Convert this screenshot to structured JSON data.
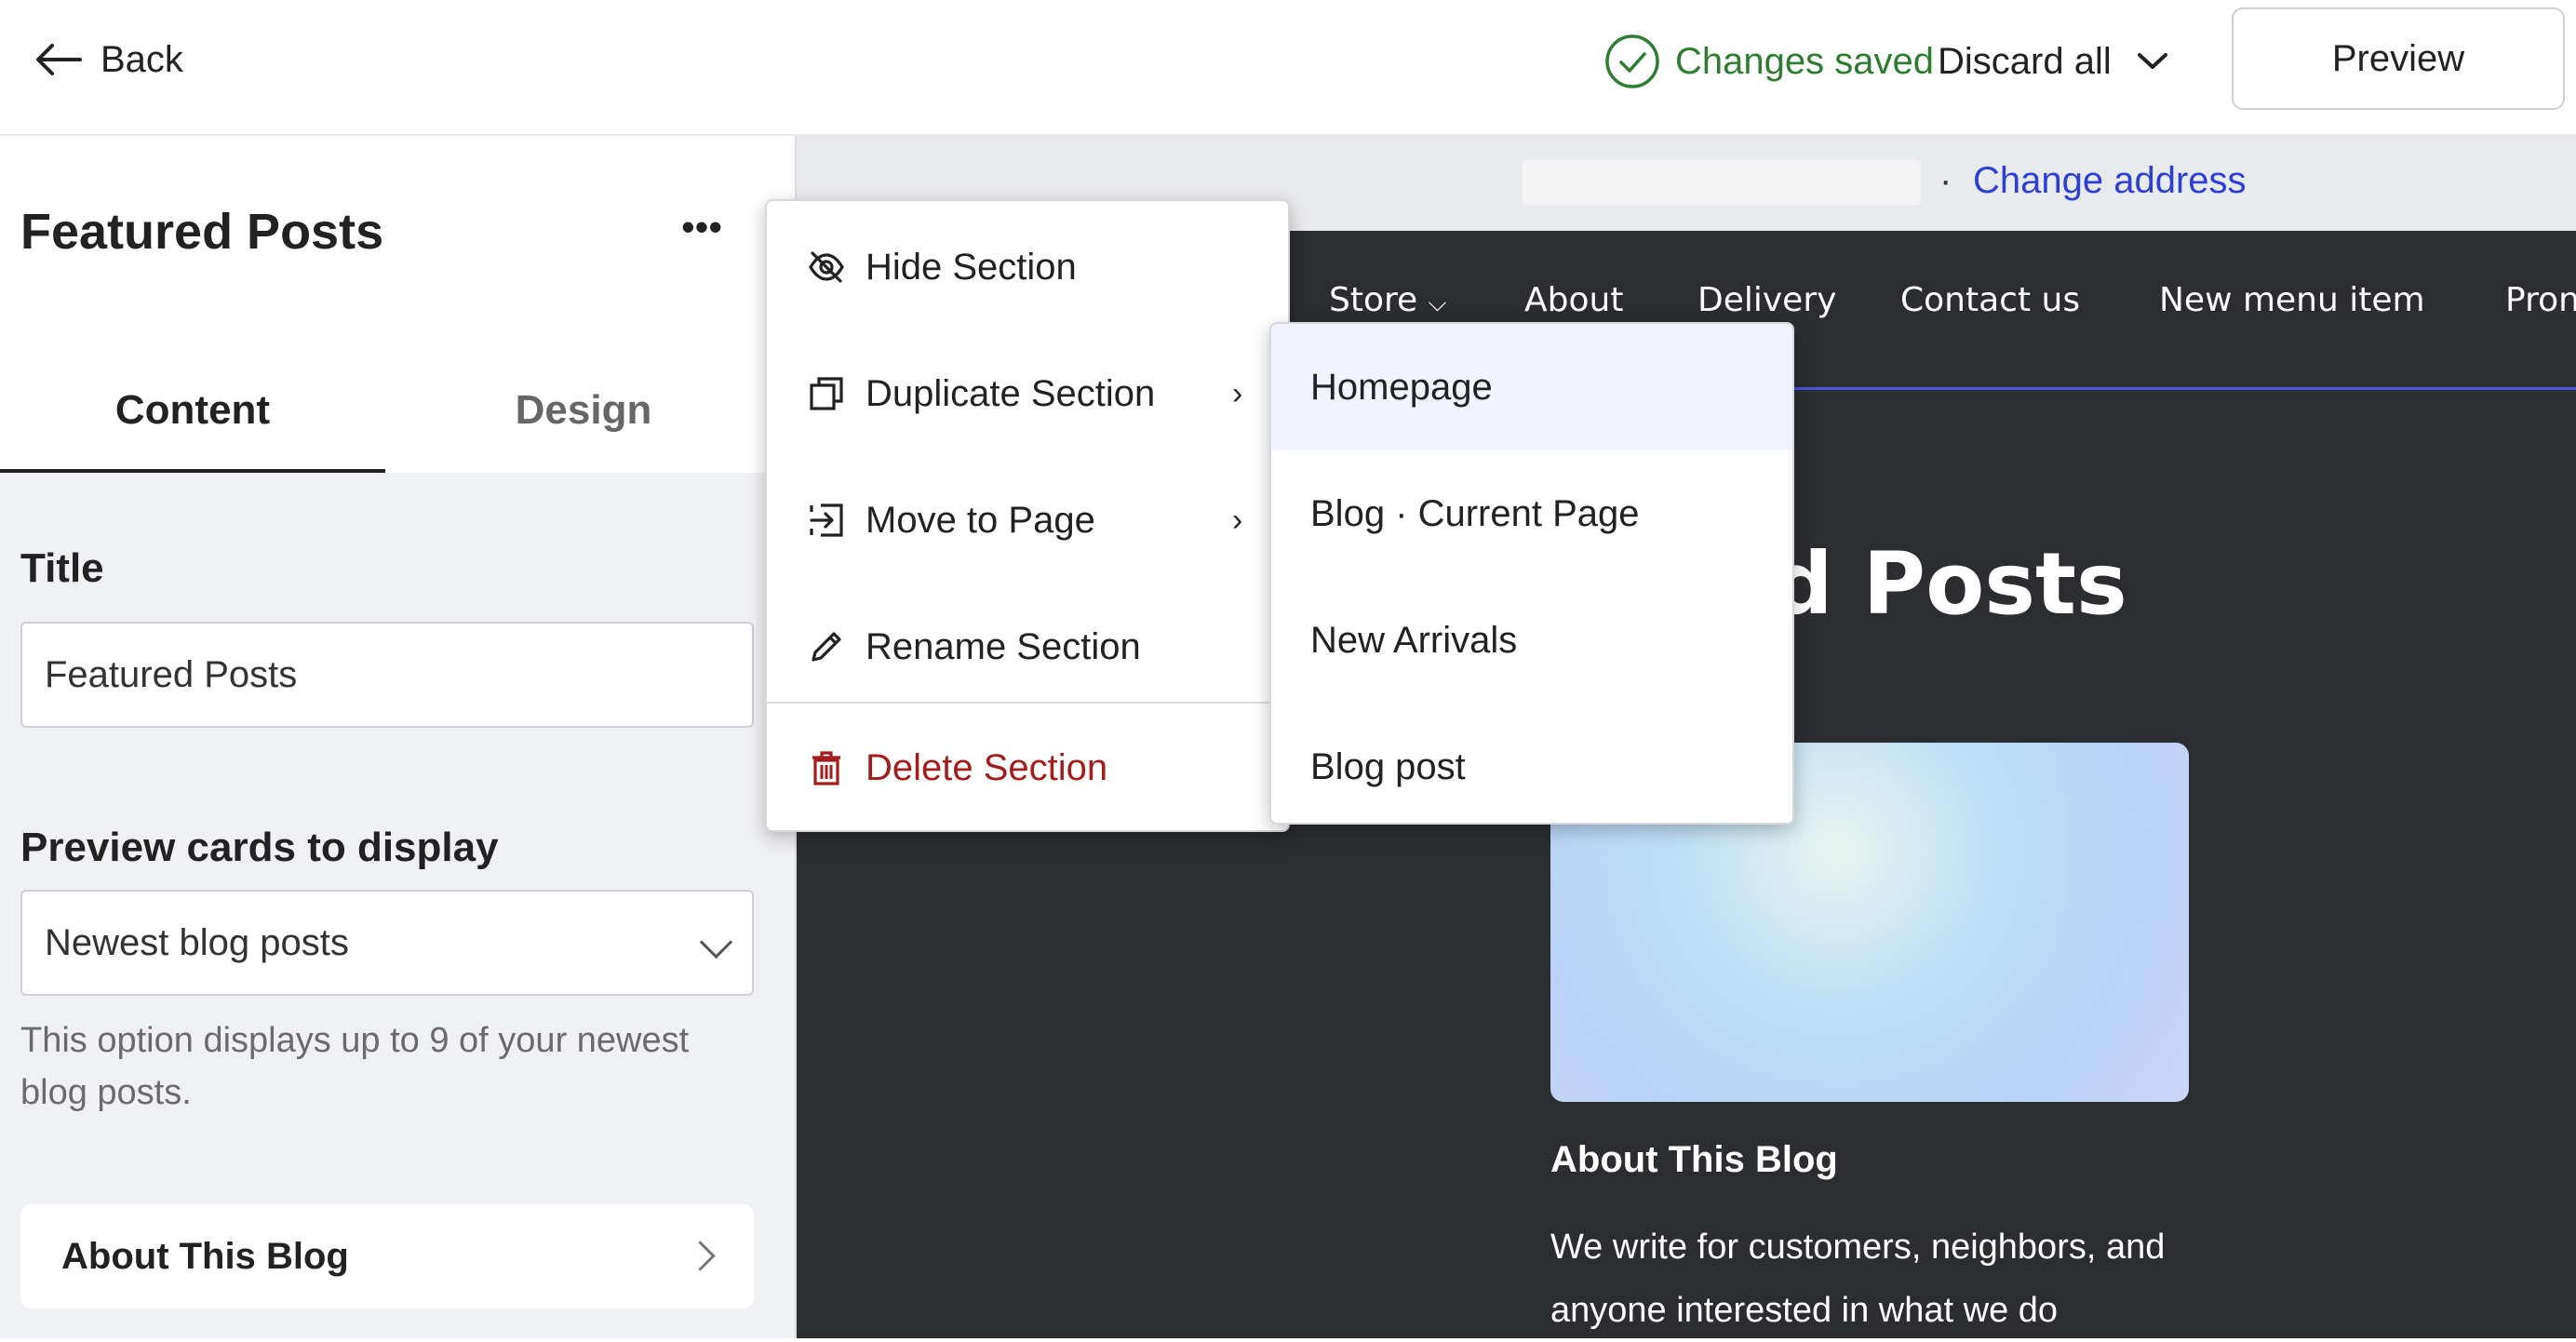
{
  "topbar": {
    "back_label": "Back",
    "status_text": "Changes saved",
    "status_color": "#2e7d32",
    "discard_label": "Discard all",
    "preview_label": "Preview"
  },
  "panel": {
    "title": "Featured Posts",
    "more_label": "•••",
    "tabs": [
      {
        "label": "Content",
        "active": true
      },
      {
        "label": "Design",
        "active": false
      }
    ],
    "title_field": {
      "label": "Title",
      "value": "Featured Posts"
    },
    "cards_field": {
      "label": "Preview cards to display",
      "value": "Newest blog posts"
    },
    "hint": "This option displays up to 9 of your newest blog posts.",
    "nav_card_label": "About This Blog"
  },
  "site": {
    "addr_dot": "·",
    "change_address": "Change address",
    "nav": [
      "Store",
      "About",
      "Delivery",
      "Contact us",
      "New menu item",
      "Pron"
    ],
    "store_caret": "⌵",
    "hero_title": "red Posts",
    "card_title": "About This Blog",
    "card_desc": "We write for customers, neighbors, and anyone interested in what we do"
  },
  "menu": {
    "items": [
      {
        "label": "Hide Section",
        "icon": "eye-off-icon"
      },
      {
        "label": "Duplicate Section",
        "icon": "duplicate-icon",
        "arrow": "›"
      },
      {
        "label": "Move to Page",
        "icon": "move-to-page-icon",
        "arrow": "›"
      },
      {
        "label": "Rename Section",
        "icon": "pencil-icon"
      },
      {
        "label": "Delete Section",
        "icon": "trash-icon",
        "danger": true
      }
    ],
    "danger_color": "#a31d1d"
  },
  "submenu": {
    "items": [
      "Homepage",
      "Blog · Current Page",
      "New Arrivals",
      "Blog post"
    ],
    "highlighted": "Homepage"
  },
  "colors": {
    "accent_link": "#2e3fd6",
    "site_background": "#2b2d31",
    "nav_underline": "#4a55d8"
  }
}
